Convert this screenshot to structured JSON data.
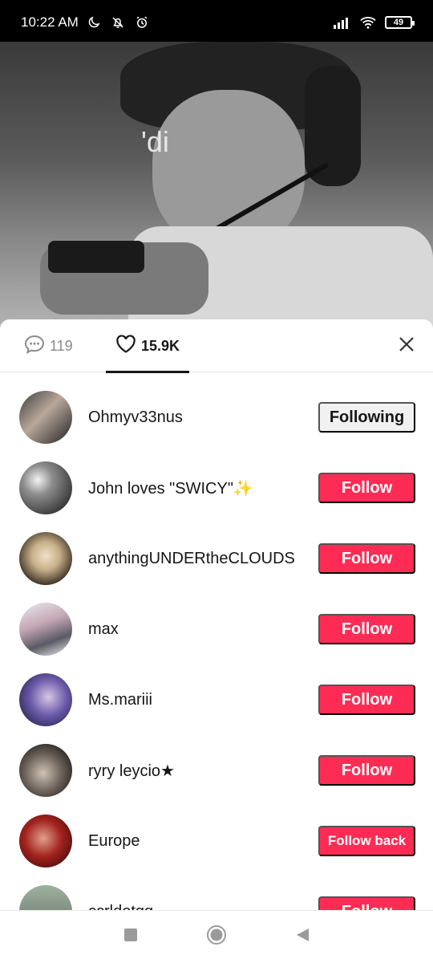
{
  "status_bar": {
    "time": "10:22 AM",
    "icons": [
      "moon-icon",
      "bell-off-icon",
      "alarm-icon",
      "signal-icon",
      "wifi-icon"
    ],
    "battery": "49"
  },
  "video": {
    "caption_text": "'di"
  },
  "tabs": {
    "comments_count": "119",
    "likes_count": "15.9K"
  },
  "likes_list": [
    {
      "name": "Ohmyv33nus",
      "button": "Following",
      "state": "following"
    },
    {
      "name": "John loves \"SWICY\"✨",
      "button": "Follow",
      "state": "follow"
    },
    {
      "name": "anythingUNDERtheCLOUDS",
      "button": "Follow",
      "state": "follow"
    },
    {
      "name": "max",
      "button": "Follow",
      "state": "follow"
    },
    {
      "name": "Ms.mariii",
      "button": "Follow",
      "state": "follow"
    },
    {
      "name": "ryry leycio★",
      "button": "Follow",
      "state": "follow"
    },
    {
      "name": "Europe",
      "button": "Follow back",
      "state": "follow-back"
    },
    {
      "name": "ccrldotgg",
      "button": "Follow",
      "state": "follow"
    }
  ],
  "colors": {
    "accent": "#fe2c55",
    "following_bg": "#f1f1f2",
    "text": "#161616"
  }
}
